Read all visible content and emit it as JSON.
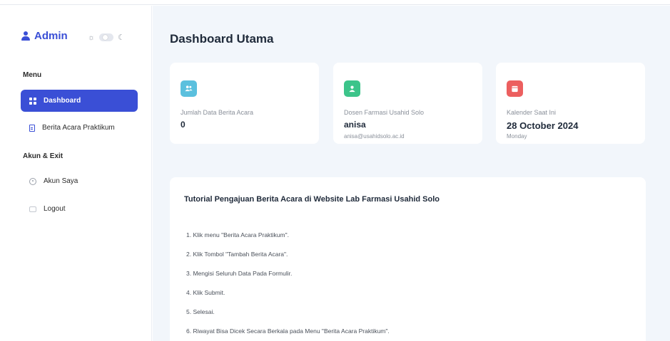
{
  "sidebar": {
    "brand": "Admin",
    "sections": [
      {
        "label": "Menu"
      },
      {
        "label": "Akun & Exit"
      }
    ],
    "items": [
      {
        "label": "Dashboard",
        "icon": "grid-icon",
        "active": true
      },
      {
        "label": "Berita Acara Praktikum",
        "icon": "document-icon",
        "active": false
      },
      {
        "label": "Akun Saya",
        "icon": "user-circle-icon",
        "active": false
      },
      {
        "label": "Logout",
        "icon": "logout-icon",
        "active": false
      }
    ]
  },
  "main": {
    "title": "Dashboard Utama",
    "cards": [
      {
        "icon": "users-icon",
        "color": "#5bc0de",
        "label": "Jumlah Data Berita Acara",
        "value": "0",
        "sub": ""
      },
      {
        "icon": "user-badge-icon",
        "color": "#3cc48a",
        "label": "Dosen Farmasi Usahid Solo",
        "value": "anisa",
        "sub": "anisa@usahidsolo.ac.id"
      },
      {
        "icon": "calendar-icon",
        "color": "#ec5f5f",
        "label": "Kalender Saat Ini",
        "value": "28 October 2024",
        "sub": "Monday"
      }
    ],
    "tutorial": {
      "title": "Tutorial Pengajuan Berita Acara di Website Lab Farmasi Usahid Solo",
      "steps": [
        "1.  Klik menu \"Berita Acara Praktikum\".",
        "2.  Klik Tombol \"Tambah Berita Acara\".",
        "3.  Mengisi Seluruh Data Pada Formulir.",
        "4.  Klik Submit.",
        "5.  Selesai.",
        "6.  Riwayat Bisa Dicek Secara Berkala pada Menu \"Berita Acara Praktikum\"."
      ]
    }
  },
  "colors": {
    "accent": "#3a4fd6",
    "background": "#f2f6fb"
  }
}
